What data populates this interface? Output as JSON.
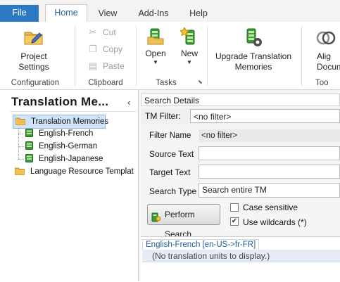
{
  "tabs": {
    "file": "File",
    "home": "Home",
    "view": "View",
    "addins": "Add-Ins",
    "help": "Help"
  },
  "ribbon": {
    "project_settings": "Project Settings",
    "configuration": "Configuration",
    "cut": "Cut",
    "copy": "Copy",
    "paste": "Paste",
    "clipboard": "Clipboard",
    "open": "Open",
    "new": "New",
    "tasks": "Tasks",
    "upgrade_tm": "Upgrade Translation Memories",
    "align_documents": "Alig\nDocume",
    "tools": "Too"
  },
  "left_pane": {
    "title": "Translation Me...",
    "collapse_glyph": "‹",
    "tree": {
      "root": "Translation Memories",
      "items": [
        "English-French",
        "English-German",
        "English-Japanese"
      ],
      "lr_templates": "Language Resource Templat"
    }
  },
  "search_details": {
    "header": "Search Details",
    "tm_filter_label": "TM Filter:",
    "tm_filter_value": "<no filter>",
    "filter_name_label": "Filter Name",
    "filter_name_value": "<no filter>",
    "source_text_label": "Source Text",
    "target_text_label": "Target Text",
    "search_type_label": "Search Type",
    "search_type_value": "Search entire TM",
    "perform_search": "Perform Search",
    "case_sensitive": "Case sensitive",
    "case_sensitive_checked": false,
    "use_wildcards": "Use wildcards (*)",
    "use_wildcards_checked": true
  },
  "results": {
    "tab_label": "English-French [en-US->fr-FR]",
    "message": "(No translation units to display.)"
  },
  "colors": {
    "file_tab": "#2b79c2",
    "home_tab_text": "#1f5d9c",
    "selection": "#cfe3fb",
    "tm_icon_green": "#3c9a3c"
  },
  "icons": {
    "project_settings": "folder-pencil-icon",
    "cut": "scissors-icon",
    "copy": "copy-icon",
    "paste": "clipboard-icon",
    "open": "tm-open-icon",
    "new": "tm-new-icon",
    "upgrade": "tm-upgrade-gear-icon",
    "align": "align-rings-icon",
    "tree_folder": "folder-icon",
    "tree_tm": "translation-memory-icon",
    "perform": "search-tm-icon"
  }
}
